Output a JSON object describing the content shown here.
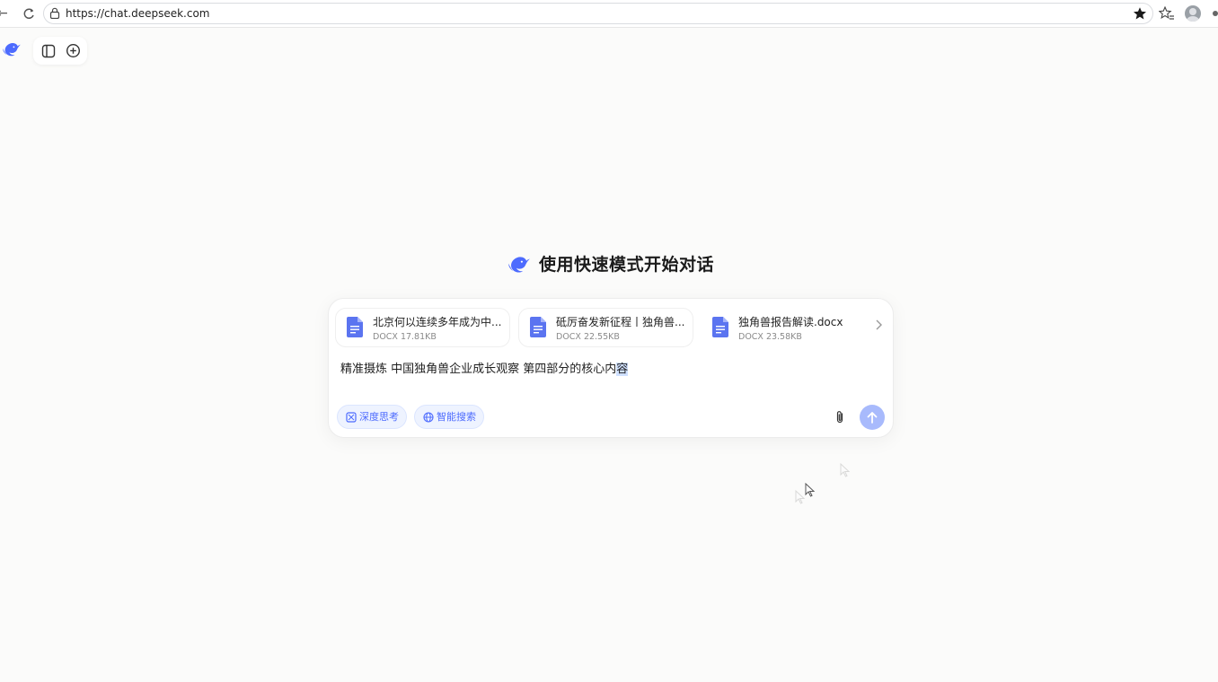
{
  "browser": {
    "url": "https://chat.deepseek.com",
    "icons": [
      "back-icon",
      "reload-icon",
      "lock-icon",
      "bookmark-star-icon",
      "reading-list-icon",
      "profile-avatar"
    ]
  },
  "app": {
    "logo_icon": "deepseek-whale-icon",
    "toolbar_icons": [
      "sidebar-toggle-icon",
      "new-chat-icon"
    ]
  },
  "hero": {
    "title": "使用快速模式开始对话"
  },
  "composer": {
    "attachments": [
      {
        "name": "北京何以连续多年成为中...",
        "meta": "DOCX 17.81KB"
      },
      {
        "name": "砥厉奋发新征程丨独角兽...",
        "meta": "DOCX 22.55KB"
      },
      {
        "name": "独角兽报告解读.docx",
        "meta": "DOCX 23.58KB"
      }
    ],
    "prompt_text": "精准摄炼 中国独角兽企业成长观察 第四部分的核心内",
    "prompt_selected": "容",
    "chips": {
      "deep_think": "深度思考",
      "web_search": "智能搜索"
    }
  },
  "colors": {
    "accent": "#4d6bfe",
    "chip_bg": "#eef3ff",
    "send_disabled": "#a8bafc",
    "doc_icon": "#5b74f0"
  }
}
